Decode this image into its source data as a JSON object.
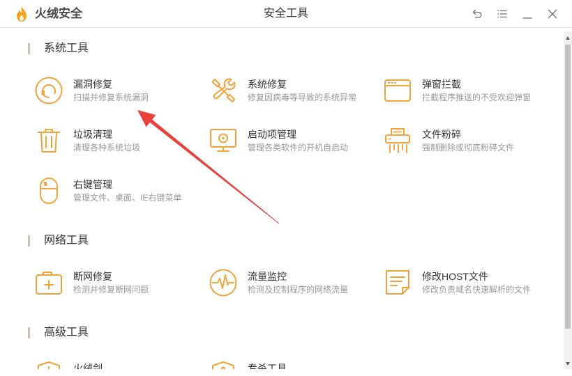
{
  "app": {
    "brand": "火绒安全",
    "title": "安全工具",
    "logo_icon": "flame-logo-icon"
  },
  "window_controls": [
    "undo-icon",
    "menu-icon",
    "minimize-icon",
    "close-icon"
  ],
  "sections": [
    {
      "title": "系统工具",
      "items": [
        {
          "icon": "headset-icon",
          "title": "漏洞修复",
          "desc": "扫描并修复系统漏洞"
        },
        {
          "icon": "wrench-screwdriver-icon",
          "title": "系统修复",
          "desc": "修复因病毒等导致的系统异常"
        },
        {
          "icon": "popup-window-icon",
          "title": "弹窗拦截",
          "desc": "拦截程序推送的不受欢迎弹窗"
        },
        {
          "icon": "trash-icon",
          "title": "垃圾清理",
          "desc": "清理各种系统垃圾"
        },
        {
          "icon": "monitor-icon",
          "title": "启动项管理",
          "desc": "管理各类软件的开机自启动"
        },
        {
          "icon": "shredder-icon",
          "title": "文件粉碎",
          "desc": "强制删除或彻底粉碎文件"
        },
        {
          "icon": "mouse-icon",
          "title": "右键管理",
          "desc": "管理文件、桌面、IE右键菜单"
        }
      ]
    },
    {
      "title": "网络工具",
      "items": [
        {
          "icon": "briefcase-plus-icon",
          "title": "断网修复",
          "desc": "检测并修复断网问题"
        },
        {
          "icon": "waveform-icon",
          "title": "流量监控",
          "desc": "检测及控制程序的网络流量"
        },
        {
          "icon": "document-edit-icon",
          "title": "修改HOST文件",
          "desc": "修改负责域名快速解析的文件"
        }
      ]
    },
    {
      "title": "高级工具",
      "items": [
        {
          "icon": "shield-icon",
          "title": "火绒剑"
        },
        {
          "icon": "shield-icon",
          "title": "专杀工具"
        }
      ]
    }
  ],
  "colors": {
    "accent": "#f2a33a",
    "annotation": "#e8413c",
    "text": "#333333",
    "subtext": "#999999",
    "section_bar": "#cbbfb1"
  }
}
